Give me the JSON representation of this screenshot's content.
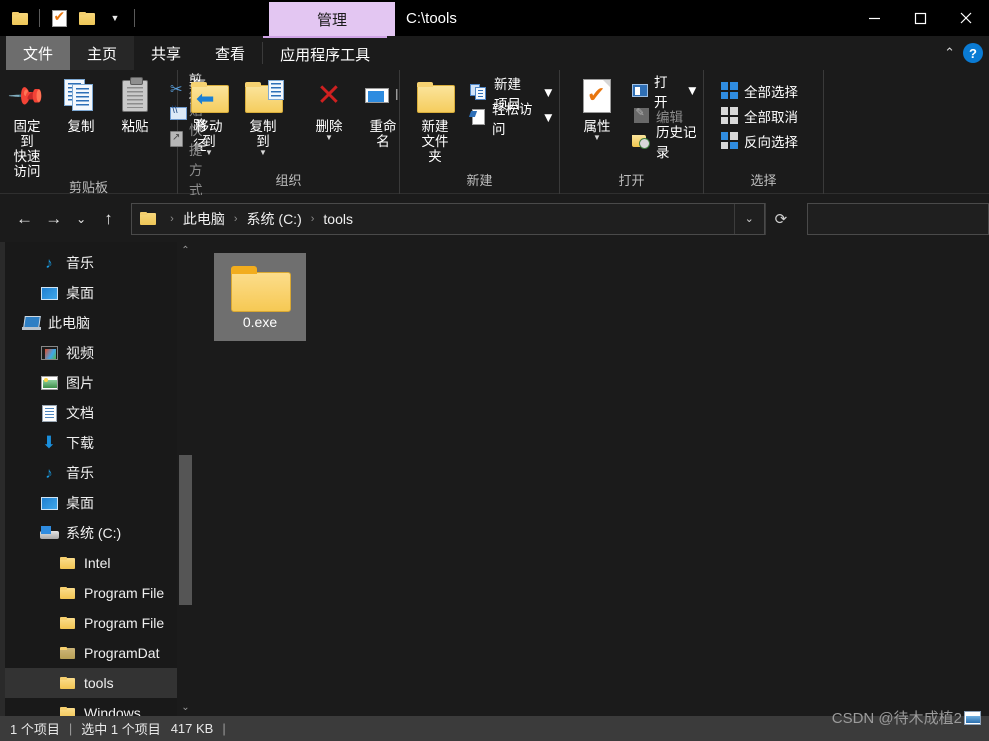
{
  "window": {
    "title": "C:\\tools",
    "quick_access": [
      "folder-icon",
      "properties-icon",
      "new-folder-icon",
      "customize-caret-icon"
    ],
    "controls": {
      "minimize": "minimize-icon",
      "maximize": "maximize-icon",
      "close": "close-icon"
    }
  },
  "contextual_tab": {
    "label": "管理"
  },
  "tabs": [
    {
      "label": "文件",
      "name": "tab-file",
      "state": "file"
    },
    {
      "label": "主页",
      "name": "tab-home",
      "state": "active"
    },
    {
      "label": "共享",
      "name": "tab-share",
      "state": "normal"
    },
    {
      "label": "查看",
      "name": "tab-view",
      "state": "normal"
    },
    {
      "label": "应用程序工具",
      "name": "tab-app-tools",
      "state": "contextual"
    }
  ],
  "ribbon_right": {
    "collapse": "chevron-up-icon",
    "help": "?"
  },
  "ribbon": {
    "groups": [
      {
        "name": "clipboard",
        "label": "剪贴板",
        "big": [
          {
            "label": "固定到\n快速访问",
            "line1": "固定到",
            "line2": "快速访问",
            "icon": "pin-icon"
          },
          {
            "label": "复制",
            "line1": "复制",
            "line2": "",
            "icon": "copy-icon"
          },
          {
            "label": "粘贴",
            "line1": "粘贴",
            "line2": "",
            "icon": "paste-icon"
          }
        ],
        "small": [
          {
            "label": "剪切",
            "icon": "scissors-icon",
            "dim": false
          },
          {
            "label": "复制路径",
            "icon": "copy-path-icon",
            "dim": false
          },
          {
            "label": "粘贴快捷方式",
            "icon": "paste-shortcut-icon",
            "dim": true
          }
        ]
      },
      {
        "name": "organize",
        "label": "组织",
        "big": [
          {
            "line1": "移动到",
            "line2": "",
            "icon": "move-to-icon",
            "dropdown": true
          },
          {
            "line1": "复制到",
            "line2": "",
            "icon": "copy-to-icon",
            "dropdown": true
          },
          {
            "line1": "删除",
            "line2": "",
            "icon": "delete-icon",
            "dropdown": true
          },
          {
            "line1": "重命名",
            "line2": "",
            "icon": "rename-icon",
            "dropdown": false
          }
        ],
        "small": []
      },
      {
        "name": "new",
        "label": "新建",
        "big": [
          {
            "line1": "新建",
            "line2": "文件夹",
            "icon": "new-folder-icon",
            "dropdown": false
          }
        ],
        "small": [
          {
            "label": "新建项目",
            "icon": "new-item-icon",
            "dim": false,
            "dropdown": true
          },
          {
            "label": "轻松访问",
            "icon": "easy-access-icon",
            "dim": false,
            "dropdown": true
          }
        ]
      },
      {
        "name": "open",
        "label": "打开",
        "big": [
          {
            "line1": "属性",
            "line2": "",
            "icon": "properties-icon",
            "dropdown": true
          }
        ],
        "small": [
          {
            "label": "打开",
            "icon": "open-icon",
            "dim": false,
            "dropdown": true
          },
          {
            "label": "编辑",
            "icon": "edit-icon",
            "dim": true,
            "dropdown": false
          },
          {
            "label": "历史记录",
            "icon": "history-icon",
            "dim": false,
            "dropdown": false
          }
        ]
      },
      {
        "name": "select",
        "label": "选择",
        "big": [],
        "small": [
          {
            "label": "全部选择",
            "icon": "select-all-icon",
            "dim": false
          },
          {
            "label": "全部取消",
            "icon": "select-none-icon",
            "dim": false
          },
          {
            "label": "反向选择",
            "icon": "invert-select-icon",
            "dim": false
          }
        ]
      }
    ]
  },
  "addressbar": {
    "back": "back-arrow-icon",
    "forward": "forward-arrow-icon",
    "recent": "chevron-down-icon",
    "up": "up-arrow-icon",
    "path_icon": "folder-icon",
    "crumbs": [
      "此电脑",
      "系统 (C:)",
      "tools"
    ],
    "separator": "›",
    "dropdown": "chevron-down-icon",
    "refresh": "refresh-icon"
  },
  "search": {
    "value": "",
    "placeholder": "",
    "icon": "search-icon"
  },
  "navpane": {
    "scroll_up": "chevron-up-icon",
    "scroll_down": "chevron-down-icon",
    "items": [
      {
        "label": "音乐",
        "icon": "music-icon",
        "indent": 1,
        "selected": false
      },
      {
        "label": "桌面",
        "icon": "desktop-icon",
        "indent": 1,
        "selected": false
      },
      {
        "label": "此电脑",
        "icon": "this-pc-icon",
        "indent": 0,
        "selected": false
      },
      {
        "label": "视频",
        "icon": "videos-icon",
        "indent": 1,
        "selected": false
      },
      {
        "label": "图片",
        "icon": "pictures-icon",
        "indent": 1,
        "selected": false
      },
      {
        "label": "文档",
        "icon": "documents-icon",
        "indent": 1,
        "selected": false
      },
      {
        "label": "下载",
        "icon": "downloads-icon",
        "indent": 1,
        "selected": false
      },
      {
        "label": "音乐",
        "icon": "music-icon",
        "indent": 1,
        "selected": false
      },
      {
        "label": "桌面",
        "icon": "desktop-icon",
        "indent": 1,
        "selected": false
      },
      {
        "label": "系统 (C:)",
        "icon": "drive-icon",
        "indent": 1,
        "selected": false
      },
      {
        "label": "Intel",
        "icon": "folder-icon",
        "indent": 2,
        "selected": false
      },
      {
        "label": "Program File",
        "icon": "folder-icon",
        "indent": 2,
        "selected": false
      },
      {
        "label": "Program File",
        "icon": "folder-icon",
        "indent": 2,
        "selected": false
      },
      {
        "label": "ProgramDat",
        "icon": "folder-dim-icon",
        "indent": 2,
        "selected": false
      },
      {
        "label": "tools",
        "icon": "folder-icon",
        "indent": 2,
        "selected": true
      },
      {
        "label": "Windows",
        "icon": "folder-icon",
        "indent": 2,
        "selected": false
      }
    ]
  },
  "files": [
    {
      "name": "0.exe",
      "icon": "folder-icon",
      "selected": true
    }
  ],
  "statusbar": {
    "item_count": "1 个项目",
    "selection": "选中 1 个项目",
    "size": "417 KB",
    "sep": "|"
  },
  "watermark": {
    "text": "CSDN @待木成植2",
    "icon": "image-icon"
  },
  "colors": {
    "window_bg": "#1b1b1b",
    "titlebar_bg": "#000000",
    "contextual_tab_bg": "#e3c6f2",
    "file_tab_bg": "#6d6d6d",
    "active_tab_bg": "#272727",
    "selection_bg": "#6f6f6f",
    "nav_selection_bg": "#333333",
    "statusbar_bg": "#3b3b3b",
    "accent_blue": "#0a7bd4",
    "folder_yellow": "#f6c954",
    "delete_red": "#cf2020"
  }
}
